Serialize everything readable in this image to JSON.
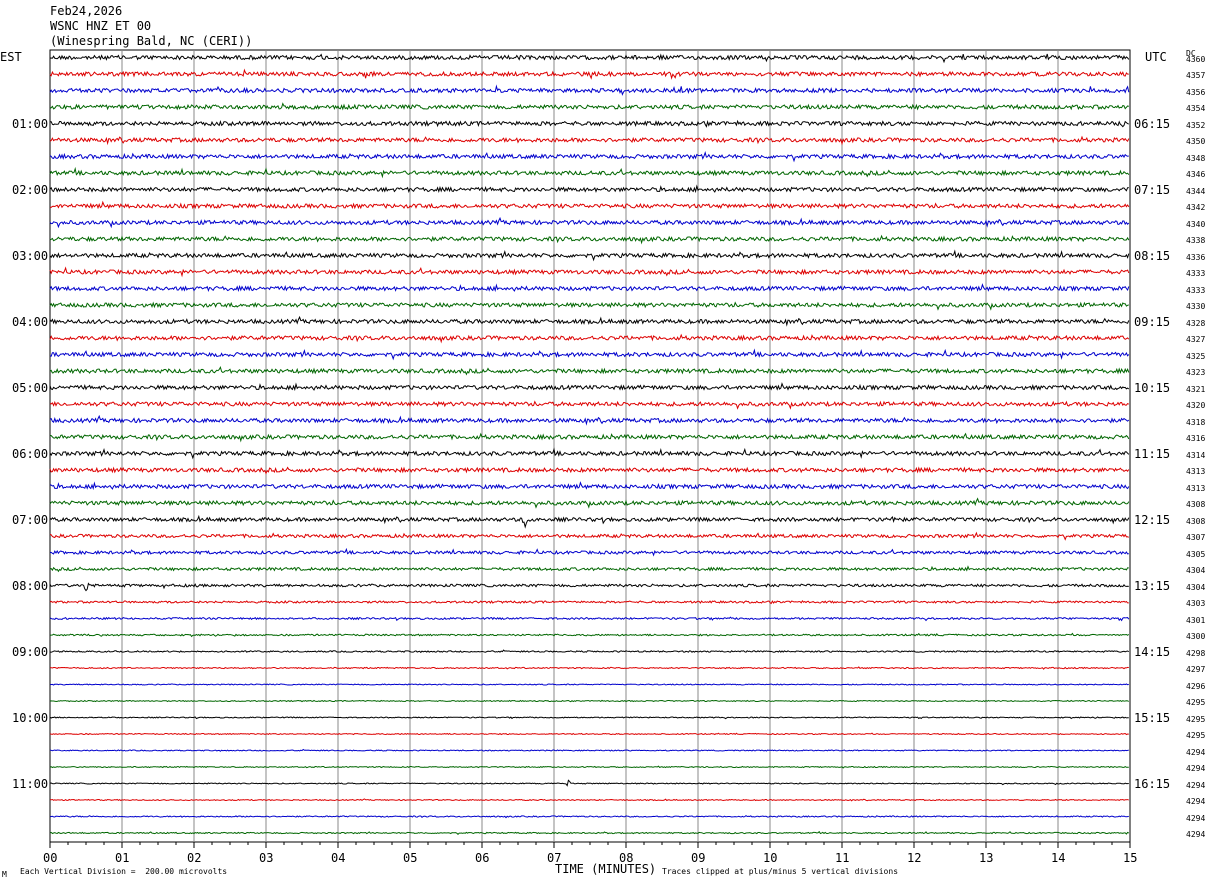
{
  "header": {
    "date": "Feb24,2026",
    "channel": "WSNC HNZ ET 00",
    "station": "(Winespring Bald, NC (CERI))"
  },
  "left_axis_label": "EST",
  "right_axis_label": "UTC",
  "dc_label": "DC",
  "footer": {
    "marker": "M",
    "division_note": "Each Vertical Division =  200.00 microvolts",
    "xlabel": "TIME (MINUTES)",
    "clip_note": "Traces clipped at plus/minus 5 vertical divisions"
  },
  "chart_data": {
    "type": "line",
    "title": "",
    "xlabel": "TIME (MINUTES)",
    "xlim": [
      0,
      15
    ],
    "x_tick_labels": [
      "00",
      "01",
      "02",
      "03",
      "04",
      "05",
      "06",
      "07",
      "08",
      "09",
      "10",
      "11",
      "12",
      "13",
      "14",
      "15"
    ],
    "rows": 48,
    "row_colors": [
      "#000000",
      "#dd0000",
      "#0000cc",
      "#006600"
    ],
    "est_labels": [
      "01:00",
      "02:00",
      "03:00",
      "04:00",
      "05:00",
      "06:00",
      "07:00",
      "08:00",
      "09:00",
      "10:00",
      "11:00"
    ],
    "utc_labels": [
      "06:15",
      "07:15",
      "08:15",
      "09:15",
      "10:15",
      "11:15",
      "12:15",
      "13:15",
      "14:15",
      "15:15",
      "16:15"
    ],
    "dc_values": [
      4360,
      4357,
      4356,
      4354,
      4352,
      4350,
      4348,
      4346,
      4344,
      4342,
      4340,
      4338,
      4336,
      4333,
      4333,
      4330,
      4328,
      4327,
      4325,
      4323,
      4321,
      4320,
      4318,
      4316,
      4314,
      4313,
      4313,
      4308,
      4308,
      4307,
      4305,
      4304,
      4304,
      4303,
      4301,
      4300,
      4298,
      4297,
      4296,
      4295,
      4295,
      4295,
      4294,
      4294,
      4294,
      4294,
      4294,
      4294
    ],
    "noise_level": [
      2.0,
      2.0,
      2.0,
      2.0,
      2.0,
      2.0,
      2.0,
      2.0,
      2.0,
      2.0,
      2.0,
      2.0,
      2.0,
      2.0,
      2.0,
      2.0,
      2.0,
      2.0,
      2.0,
      2.0,
      2.0,
      2.0,
      2.0,
      2.0,
      2.0,
      2.0,
      2.0,
      2.0,
      1.8,
      1.6,
      1.5,
      1.4,
      1.3,
      1.0,
      0.9,
      0.8,
      0.7,
      0.6,
      0.5,
      0.5,
      0.5,
      0.5,
      0.5,
      0.5,
      0.5,
      0.5,
      0.6,
      0.6
    ],
    "units_per_division": "200.00 microvolts",
    "clip_divisions": 5
  }
}
